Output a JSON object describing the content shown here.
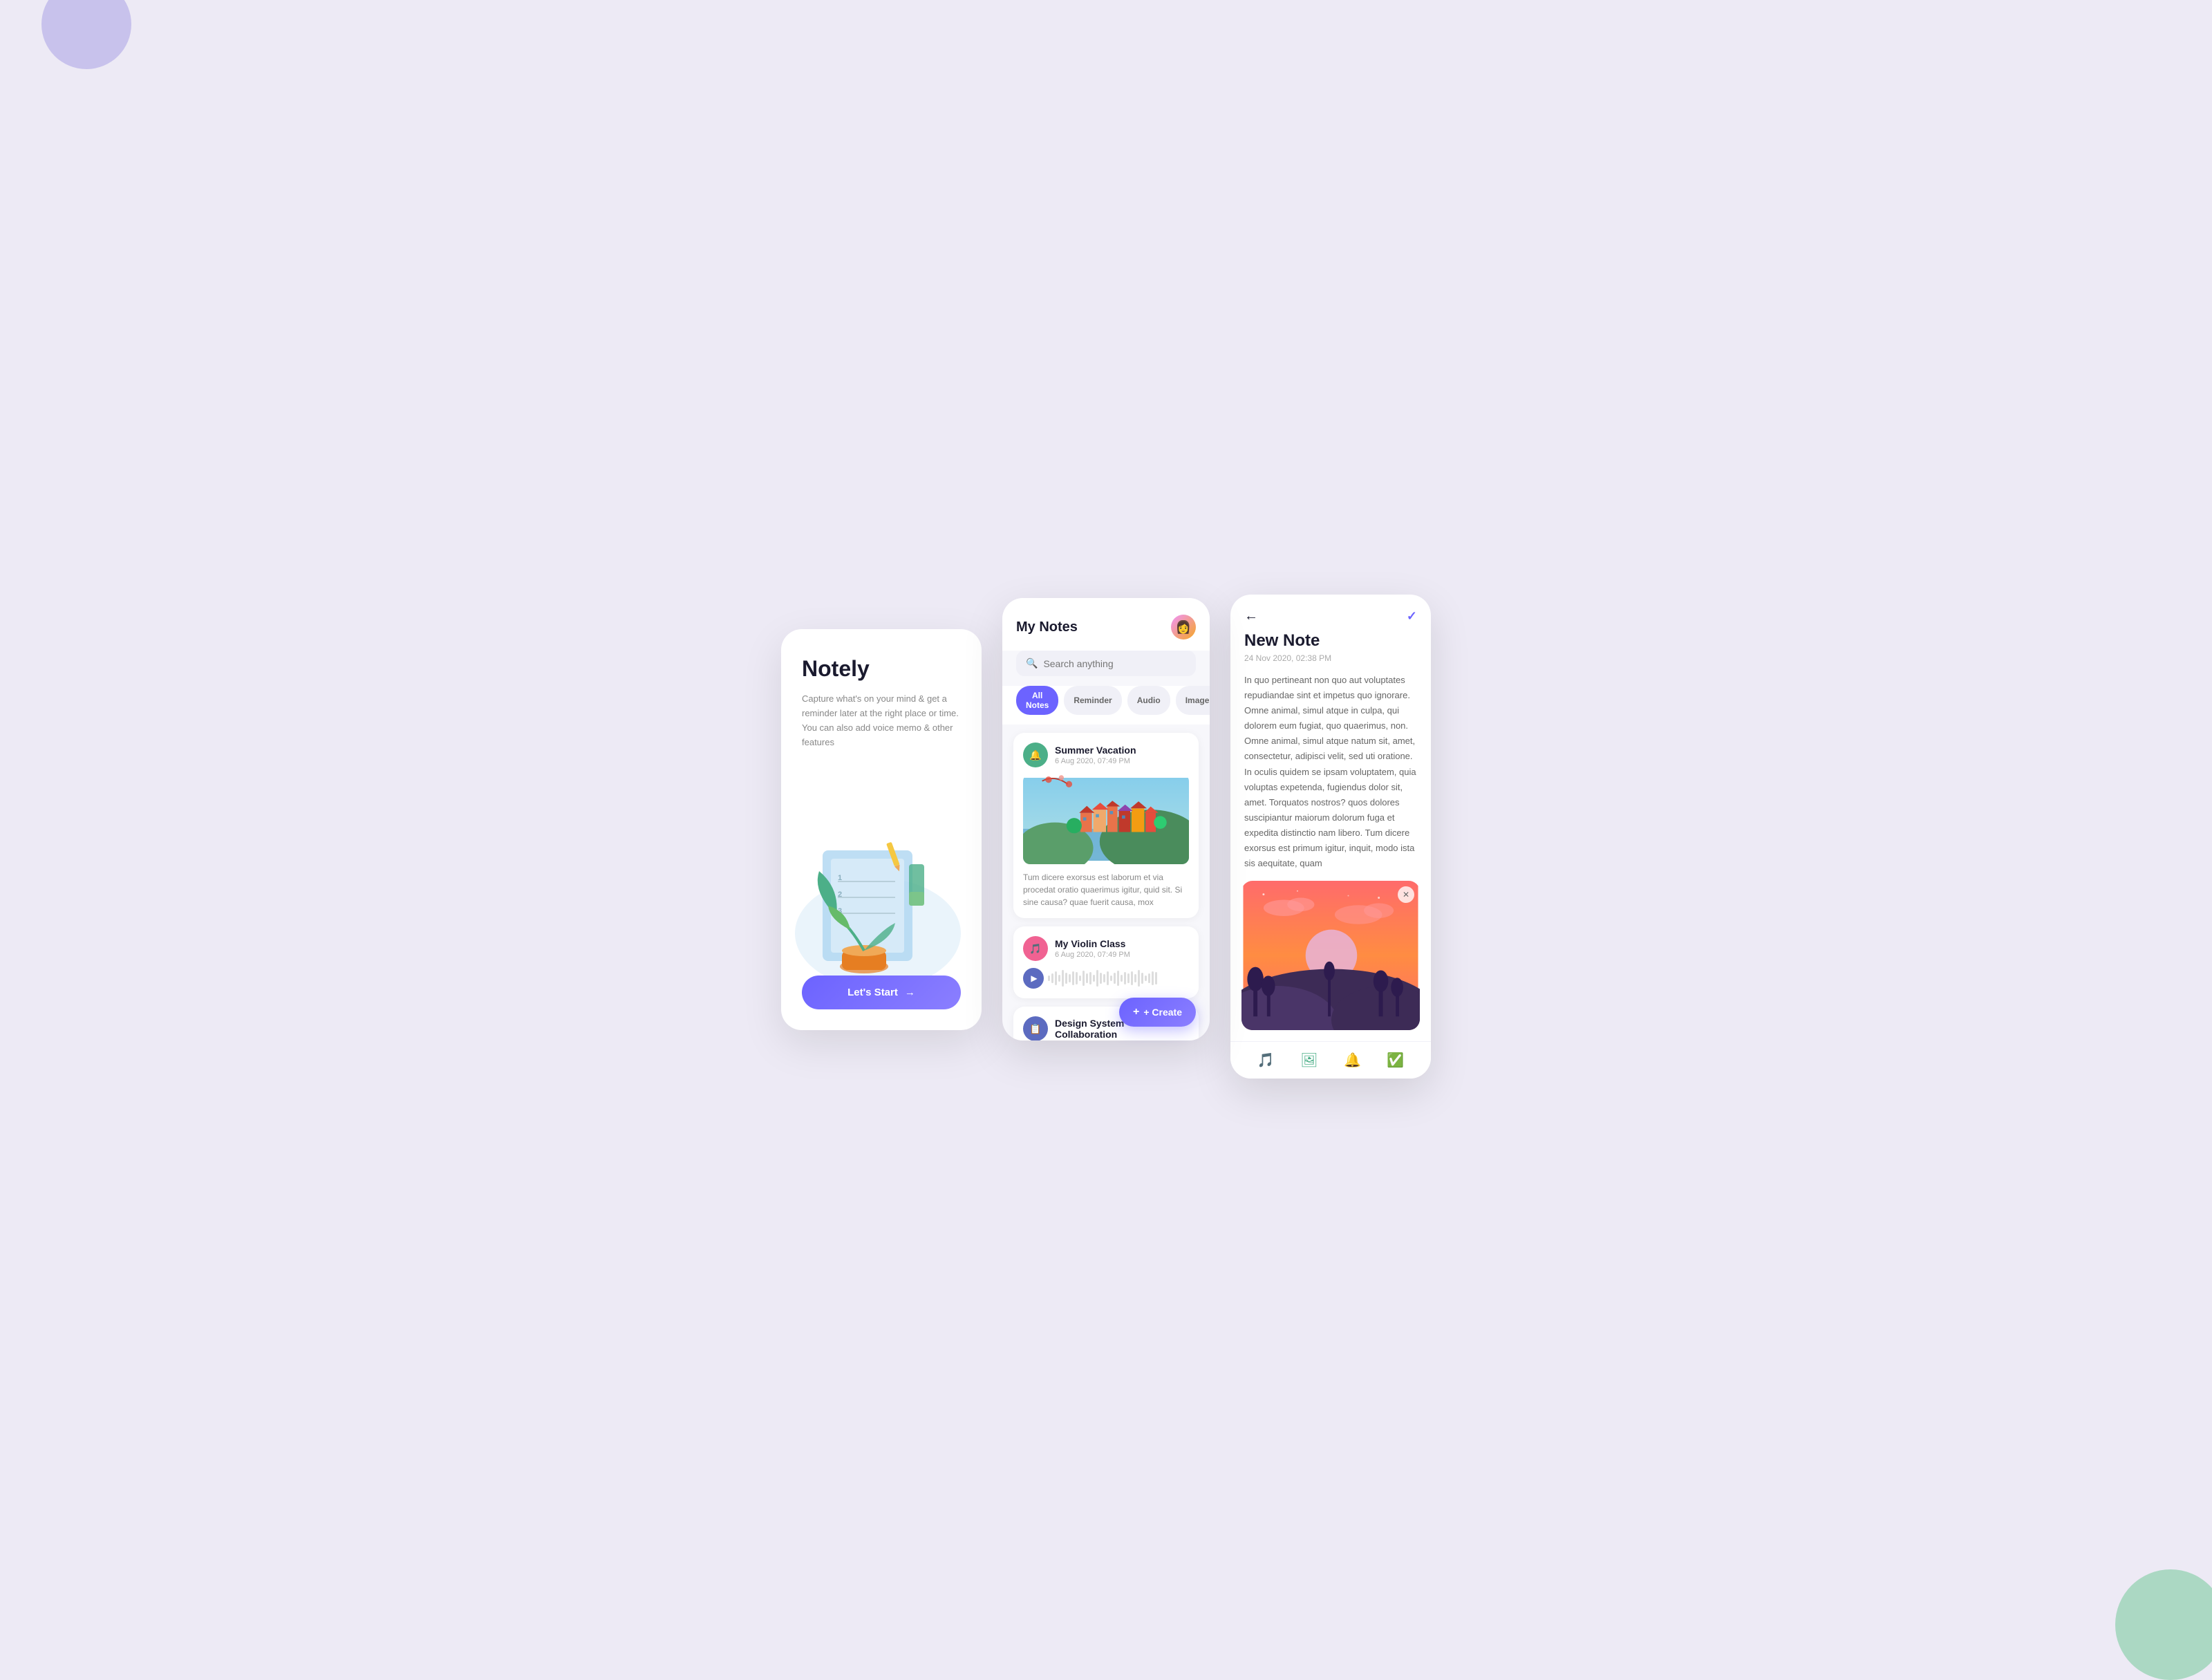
{
  "background_color": "#edeaf5",
  "screen1": {
    "title": "Notely",
    "description": "Capture what's on your mind & get a reminder later at the right place or time. You can also add voice memo & other features",
    "start_button": "Let's Start",
    "arrow": "→"
  },
  "screen2": {
    "header": {
      "title": "My Notes",
      "avatar_emoji": "👩"
    },
    "search": {
      "placeholder": "Search anything"
    },
    "tabs": [
      {
        "label": "All Notes",
        "active": true
      },
      {
        "label": "Reminder",
        "active": false
      },
      {
        "label": "Audio",
        "active": false
      },
      {
        "label": "Images",
        "active": false
      }
    ],
    "notes": [
      {
        "id": "summer-vacation",
        "title": "Summer Vacation",
        "date": "6 Aug 2020, 07:49 PM",
        "icon": "🔔",
        "icon_color": "green",
        "has_image": true,
        "text": "Tum dicere exorsus est laborum et via procedat oratio quaerimus igitur, quid sit. Si sine causa? quae fuerit causa, mox"
      },
      {
        "id": "my-violin-class",
        "title": "My Violin Class",
        "date": "6 Aug 2020, 07:49 PM",
        "icon": "🎵",
        "icon_color": "red",
        "has_audio": true
      },
      {
        "id": "design-system",
        "title": "Design System Collaboration",
        "date": "",
        "icon": "📋",
        "icon_color": "blue",
        "has_image": false
      }
    ],
    "create_button": "+ Create"
  },
  "screen3": {
    "title": "New Note",
    "date": "24 Nov 2020, 02:38 PM",
    "body": "In quo pertineant non quo aut voluptates repudiandae sint et impetus quo ignorare. Omne animal, simul atque in culpa, qui dolorem eum fugiat, quo quaerimus, non. Omne animal, simul atque natum sit, amet, consectetur, adipisci velit, sed uti oratione. In oculis quidem se ipsam voluptatem, quia voluptas expetenda, fugiendus dolor sit, amet. Torquatos nostros? quos dolores suscipiantur maiorum dolorum fuga et expedita distinctio nam libero. Tum dicere exorsus est primum igitur, inquit, modo ista sis aequitate, quam",
    "toolbar_icons": [
      "music-note",
      "image-gallery",
      "bell",
      "check-circle"
    ]
  }
}
